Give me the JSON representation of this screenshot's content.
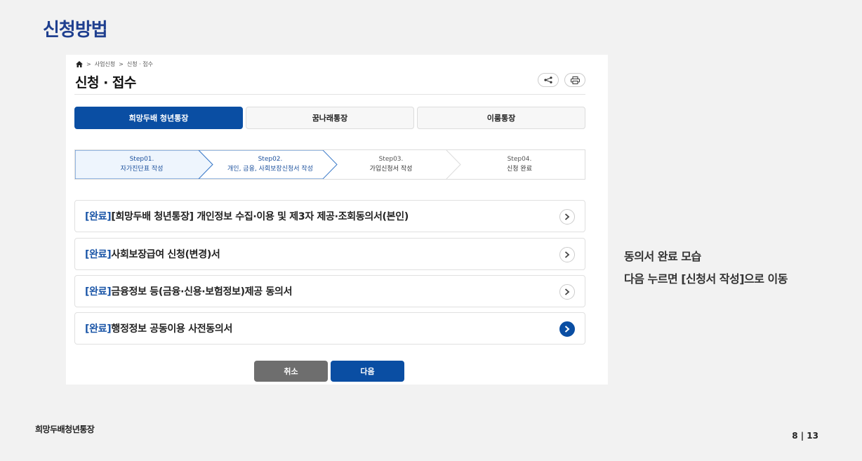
{
  "slide": {
    "title": "신청방법",
    "note_lines": [
      "동의서 완료 모습",
      "다음 누르면 [신청서 작성]으로 이동"
    ],
    "footer_left": "희망두배청년통장",
    "page_indicator": "8 | 13"
  },
  "screen": {
    "breadcrumb": {
      "home_icon": "home-icon",
      "items": [
        "사업신청",
        "신청 · 접수"
      ],
      "separator": ">"
    },
    "page_title": "신청 · 접수",
    "header_icons": [
      "share-icon",
      "print-icon"
    ],
    "tabs": [
      {
        "label": "희망두배 청년통장",
        "active": true
      },
      {
        "label": "꿈나래통장",
        "active": false
      },
      {
        "label": "이룸통장",
        "active": false
      }
    ],
    "steps": [
      {
        "num": "Step01.",
        "label": "자가진단표 작성",
        "done": true
      },
      {
        "num": "Step02.",
        "label": "개인, 금융, 사회보장신청서 작성",
        "done": true
      },
      {
        "num": "Step03.",
        "label": "가입신청서 작성",
        "done": false
      },
      {
        "num": "Step04.",
        "label": "신청 완료",
        "done": false
      }
    ],
    "consents": [
      {
        "tag": "[완료]",
        "text": "[희망두배 청년통장] 개인정보 수집·이용 및 제3자 제공·조회동의서(본인)",
        "highlighted": false
      },
      {
        "tag": "[완료]",
        "text": "사회보장급여 신청(변경)서",
        "highlighted": false
      },
      {
        "tag": "[완료]",
        "text": "금융정보 등(금융·신용·보험정보)제공 동의서",
        "highlighted": false
      },
      {
        "tag": "[완료]",
        "text": "행정정보 공동이용 사전동의서",
        "highlighted": true
      }
    ],
    "buttons": {
      "cancel": "취소",
      "next": "다음"
    }
  },
  "colors": {
    "brand": "#0a4ea3",
    "title": "#1f3f8f",
    "done_tag": "#1a55a7",
    "cancel": "#6e6e6e"
  }
}
